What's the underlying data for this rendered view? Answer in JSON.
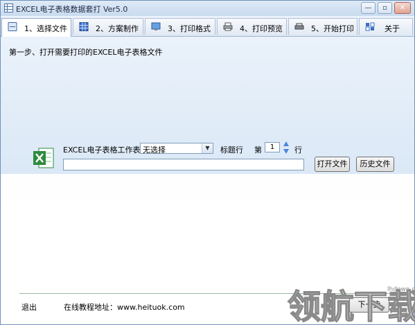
{
  "window": {
    "title": "EXCEL电子表格数据套打 Ver5.0",
    "min": "—",
    "max": "▫",
    "close": "✕"
  },
  "tabs": [
    {
      "label": "1、选择文件",
      "icon": "file-icon",
      "active": true
    },
    {
      "label": "2、方案制作",
      "icon": "grid-icon",
      "active": false
    },
    {
      "label": "3、打印格式",
      "icon": "monitor-icon",
      "active": false
    },
    {
      "label": "4、打印预览",
      "icon": "printer-preview-icon",
      "active": false
    },
    {
      "label": "5、开始打印",
      "icon": "printer-icon",
      "active": false
    },
    {
      "label": "关于",
      "icon": "about-icon",
      "active": false
    }
  ],
  "main": {
    "step_text": "第一步、打开需要打印的EXCEL电子表格文件",
    "sheet_label": "EXCEL电子表格工作表",
    "sheet_select_value": "无选择",
    "title_row_label": "标题行",
    "di": "第",
    "title_row_value": "1",
    "hang": "行",
    "path_value": "",
    "open_file": "打开文件",
    "history_file": "历史文件"
  },
  "footer": {
    "exit": "退出",
    "online": "在线教程地址：www.heituok.com",
    "next": "下一步"
  },
  "watermark": {
    "text": "领航下载",
    "small": "lhdown.com"
  },
  "colors": {
    "accent": "#6f8fb8",
    "excel_green": "#2e8b3e"
  }
}
